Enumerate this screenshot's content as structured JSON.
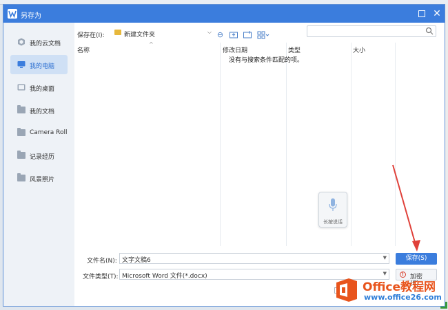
{
  "dialog": {
    "title": "另存为"
  },
  "sidebar": {
    "items": [
      {
        "label": "我的云文档",
        "icon": "cloud-doc-icon"
      },
      {
        "label": "我的电脑",
        "icon": "computer-icon"
      },
      {
        "label": "我的桌面",
        "icon": "desktop-icon"
      },
      {
        "label": "我的文档",
        "icon": "folder-icon"
      },
      {
        "label": "Camera Roll",
        "icon": "folder-icon"
      },
      {
        "label": "记录经历",
        "icon": "folder-icon"
      },
      {
        "label": "风景照片",
        "icon": "folder-icon"
      }
    ],
    "active_index": 1
  },
  "location": {
    "label": "保存在(I):",
    "value": "新建文件夹"
  },
  "columns": [
    "名称",
    "修改日期",
    "类型",
    "大小"
  ],
  "empty_message": "没有与搜索条件匹配的项。",
  "voice": {
    "label": "长按说话"
  },
  "filename": {
    "label": "文件名(N):",
    "value": "文字文稿6"
  },
  "filetype": {
    "label": "文件类型(T):",
    "value": "Microsoft Word 文件(*.docx)"
  },
  "buttons": {
    "save": "保存(S)",
    "encrypt": "加密(E)..."
  },
  "watermark": {
    "line1": "Office教程网",
    "line2": "www.office26.com"
  },
  "colors": {
    "accent": "#3b7ddd",
    "arrow": "#e0413a"
  }
}
